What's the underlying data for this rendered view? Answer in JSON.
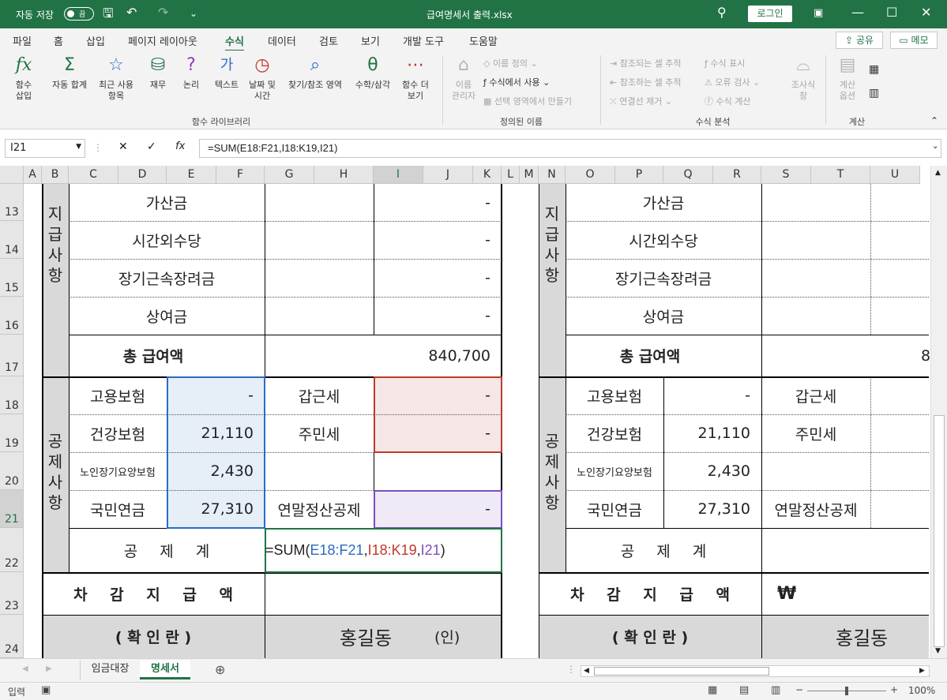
{
  "title_bar": {
    "autosave_label": "자동 저장",
    "autosave_state": "끔",
    "file_name": "급여명세서 출력.xlsx",
    "login_label": "로그인"
  },
  "ribbon_tabs": [
    "파일",
    "홈",
    "삽입",
    "페이지 레이아웃",
    "수식",
    "데이터",
    "검토",
    "보기",
    "개발 도구",
    "도움말"
  ],
  "share_label": "공유",
  "memo_label": "메모",
  "ribbon": {
    "insert_function": "함수\n삽입",
    "autosum": "자동 합계",
    "recent": "최근 사용\n항목",
    "financial": "재무",
    "logical": "논리",
    "text": "텍스트",
    "datetime": "날짜 및\n시간",
    "lookup": "찾기/참조 영역",
    "math": "수학/삼각",
    "more": "함수 더\n보기",
    "group_library": "함수 라이브러리",
    "name_manager": "이름\n관리자",
    "define_name": "이름 정의",
    "use_in_formula": "수식에서 사용",
    "create_from_selection": "선택 영역에서 만들기",
    "group_names": "정의된 이름",
    "trace_precedents": "참조되는 셀 추적",
    "trace_dependents": "참조하는 셀 추적",
    "remove_arrows": "연결선 제거",
    "show_formulas": "수식 표시",
    "error_checking": "오류 검사",
    "evaluate_formula": "수식 계산",
    "watch_window": "조사식\n창",
    "group_auditing": "수식 분석",
    "calc_options": "계산\n옵션",
    "group_calc": "계산"
  },
  "name_box": "I21",
  "formula": "=SUM(E18:F21,I18:K19,I21)",
  "columns": [
    "A",
    "B",
    "C",
    "D",
    "E",
    "F",
    "G",
    "H",
    "I",
    "J",
    "K",
    "L",
    "M",
    "N",
    "O",
    "P",
    "Q",
    "R",
    "S",
    "T",
    "U"
  ],
  "rows": [
    "13",
    "14",
    "15",
    "16",
    "17",
    "18",
    "19",
    "20",
    "21",
    "22",
    "23",
    "24"
  ],
  "sheet": {
    "left": {
      "pay_vertical": "지급사항",
      "ded_vertical": "공제사항",
      "r13": "가산금",
      "r14": "시간외수당",
      "r15": "장기근속장려금",
      "r16": "상여금",
      "dash": "-",
      "total_label": "총 급여액",
      "total_value": "840,700",
      "r18": "고용보험",
      "r18v": "-",
      "r18t": "갑근세",
      "r18tv": "-",
      "r19": "건강보험",
      "r19v": "21,110",
      "r19t": "주민세",
      "r19tv": "-",
      "r20": "노인장기요양보험",
      "r20v": "2,430",
      "r21": "국민연금",
      "r21v": "27,310",
      "r21t": "연말정산공제",
      "r21tv": "-",
      "r22": "공 제 계",
      "edit_prefix": "=SUM(",
      "edit_a": "E18:F21",
      ",": ",",
      "edit_b": "I18:K19",
      "edit_c": "I21",
      "edit_suffix": ")",
      "r23": "차 감 지 급 액",
      "r24": "( 확 인 란 )",
      "r24name": "홍길동",
      "r24seal": "(인)"
    },
    "right": {
      "pay_vertical": "지급사항",
      "ded_vertical": "공제사항",
      "r13": "가산금",
      "r14": "시간외수당",
      "r15": "장기근속장려금",
      "r16": "상여금",
      "total_label": "총 급여액",
      "total_partial": "8",
      "r18": "고용보험",
      "r18v": "-",
      "r18t": "갑근세",
      "r19": "건강보험",
      "r19v": "21,110",
      "r19t": "주민세",
      "r20": "노인장기요양보험",
      "r20v": "2,430",
      "r21": "국민연금",
      "r21v": "27,310",
      "r21t": "연말정산공제",
      "r22": "공 제 계",
      "r23": "차 감 지 급 액",
      "r23v": "₩",
      "r24": "( 확 인 란 )",
      "r24name": "홍길동"
    }
  },
  "sheet_tabs": [
    "임금대장",
    "명세서"
  ],
  "status": {
    "mode": "입력",
    "zoom": "100%"
  }
}
